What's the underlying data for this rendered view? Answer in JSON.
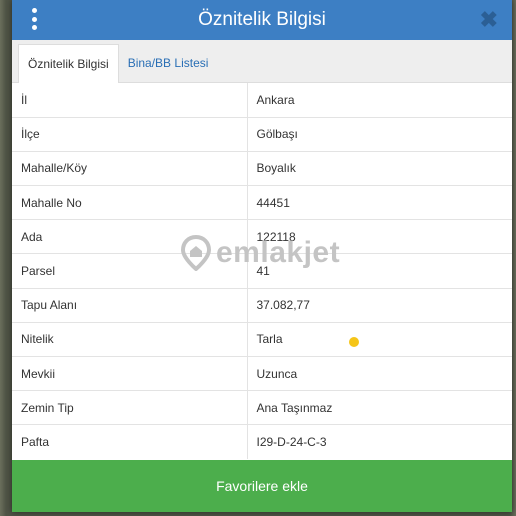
{
  "header": {
    "title": "Öznitelik Bilgisi"
  },
  "tabs": [
    {
      "label": "Öznitelik Bilgisi",
      "active": true
    },
    {
      "label": "Bina/BB Listesi",
      "active": false
    }
  ],
  "rows": [
    {
      "label": "İl",
      "value": "Ankara"
    },
    {
      "label": "İlçe",
      "value": "Gölbaşı"
    },
    {
      "label": "Mahalle/Köy",
      "value": "Boyalık"
    },
    {
      "label": "Mahalle No",
      "value": "44451"
    },
    {
      "label": "Ada",
      "value": "122118"
    },
    {
      "label": "Parsel",
      "value": "41"
    },
    {
      "label": "Tapu Alanı",
      "value": "37.082,77"
    },
    {
      "label": "Nitelik",
      "value": "Tarla"
    },
    {
      "label": "Mevkii",
      "value": "Uzunca"
    },
    {
      "label": "Zemin Tip",
      "value": "Ana Taşınmaz"
    },
    {
      "label": "Pafta",
      "value": "I29-D-24-C-3"
    }
  ],
  "watermark": {
    "text": "emlakjet"
  },
  "footer": {
    "favorite_label": "Favorilere ekle"
  },
  "colors": {
    "header": "#3d7fc4",
    "button": "#4cae4c",
    "marker": "#f5c518"
  }
}
